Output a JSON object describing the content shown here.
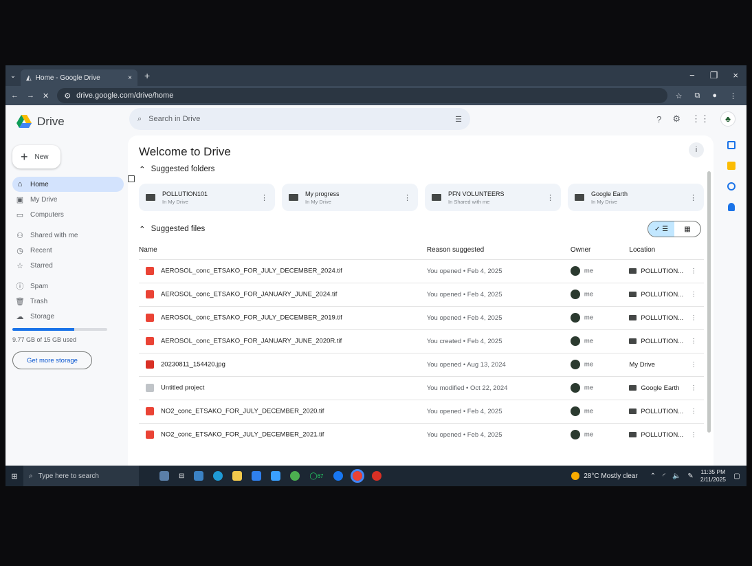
{
  "browser": {
    "tab_title": "Home - Google Drive",
    "tab_close": "×",
    "new_tab": "+",
    "url": "drive.google.com/drive/home",
    "window_controls": [
      "−",
      "❐",
      "×"
    ]
  },
  "drive": {
    "app_name": "Drive",
    "new_label": "New",
    "search_placeholder": "Search in Drive",
    "nav": [
      {
        "label": "Home",
        "icon": "home-icon"
      },
      {
        "label": "My Drive",
        "icon": "my-drive-icon"
      },
      {
        "label": "Computers",
        "icon": "computers-icon"
      },
      {
        "label": "Shared with me",
        "icon": "shared-icon"
      },
      {
        "label": "Recent",
        "icon": "recent-icon"
      },
      {
        "label": "Starred",
        "icon": "star-icon"
      },
      {
        "label": "Spam",
        "icon": "spam-icon"
      },
      {
        "label": "Trash",
        "icon": "trash-icon"
      },
      {
        "label": "Storage",
        "icon": "cloud-icon"
      }
    ],
    "storage_used": "9.77 GB of 15 GB used",
    "storage_fraction": 0.65,
    "get_more_storage": "Get more storage"
  },
  "main": {
    "welcome": "Welcome to Drive",
    "suggested_folders_label": "Suggested folders",
    "suggested_files_label": "Suggested files",
    "folders": [
      {
        "name": "POLLUTION101",
        "sub": "In My Drive"
      },
      {
        "name": "My progress",
        "sub": "In My Drive"
      },
      {
        "name": "PFN VOLUNTEERS",
        "sub": "In Shared with me"
      },
      {
        "name": "Google Earth",
        "sub": "In My Drive"
      }
    ],
    "columns": {
      "name": "Name",
      "reason": "Reason suggested",
      "owner": "Owner",
      "location": "Location"
    },
    "files": [
      {
        "name": "AEROSOL_conc_ETSAKO_FOR_JULY_DECEMBER_2024.tif",
        "reason": "You opened • Feb 4, 2025",
        "owner": "me",
        "location": "POLLUTION..."
      },
      {
        "name": "AEROSOL_conc_ETSAKO_FOR_JANUARY_JUNE_2024.tif",
        "reason": "You opened • Feb 4, 2025",
        "owner": "me",
        "location": "POLLUTION..."
      },
      {
        "name": "AEROSOL_conc_ETSAKO_FOR_JULY_DECEMBER_2019.tif",
        "reason": "You opened • Feb 4, 2025",
        "owner": "me",
        "location": "POLLUTION..."
      },
      {
        "name": "AEROSOL_conc_ETSAKO_FOR_JANUARY_JUNE_2020R.tif",
        "reason": "You created • Feb 4, 2025",
        "owner": "me",
        "location": "POLLUTION..."
      },
      {
        "name": "20230811_154420.jpg",
        "reason": "You opened • Aug 13, 2024",
        "owner": "me",
        "location": "My Drive"
      },
      {
        "name": "Untitled project",
        "reason": "You modified • Oct 22, 2024",
        "owner": "me",
        "location": "Google Earth"
      },
      {
        "name": "NO2_conc_ETSAKO_FOR_JULY_DECEMBER_2020.tif",
        "reason": "You opened • Feb 4, 2025",
        "owner": "me",
        "location": "POLLUTION..."
      },
      {
        "name": "NO2_conc_ETSAKO_FOR_JULY_DECEMBER_2021.tif",
        "reason": "You opened • Feb 4, 2025",
        "owner": "me",
        "location": "POLLUTION..."
      }
    ]
  },
  "taskbar": {
    "search_placeholder": "Type here to search",
    "weather": "28°C  Mostly clear",
    "time": "11:35 PM",
    "date": "2/11/2025",
    "badge": "67"
  },
  "colors": {
    "accent": "#1a73e8",
    "active_nav": "#d3e3fd",
    "file_red": "#ea4335"
  }
}
